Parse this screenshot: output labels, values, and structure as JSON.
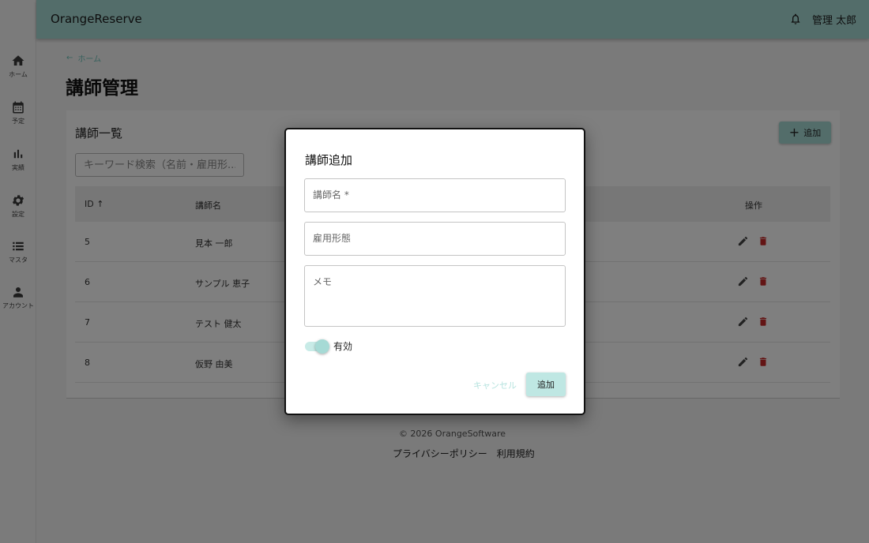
{
  "app": {
    "title": "OrangeReserve"
  },
  "header": {
    "user_name": "管理 太郎"
  },
  "sidebar": {
    "items": [
      {
        "label": "ホーム",
        "icon": "home-icon"
      },
      {
        "label": "予定",
        "icon": "calendar-icon"
      },
      {
        "label": "実績",
        "icon": "bar-chart-icon"
      },
      {
        "label": "設定",
        "icon": "gear-icon"
      },
      {
        "label": "マスタ",
        "icon": "list-icon"
      },
      {
        "label": "アカウント",
        "icon": "person-icon"
      }
    ]
  },
  "breadcrumb": {
    "label": "ホーム"
  },
  "page": {
    "title": "講師管理"
  },
  "list": {
    "title": "講師一覧",
    "add_label": "追加",
    "search_placeholder": "キーワード検索（名前・雇用形..."
  },
  "table": {
    "headers": {
      "id": "ID ↑",
      "name": "講師名",
      "actions": "操作"
    },
    "rows": [
      {
        "id": "5",
        "name": "見本 一郎"
      },
      {
        "id": "6",
        "name": "サンプル 恵子"
      },
      {
        "id": "7",
        "name": "テスト 健太"
      },
      {
        "id": "8",
        "name": "仮野 由美"
      }
    ]
  },
  "footer": {
    "copyright": "© 2026 OrangeSoftware",
    "privacy": "プライバシーポリシー",
    "terms": "利用規約"
  },
  "dialog": {
    "title": "講師追加",
    "name_placeholder": "講師名 *",
    "employment_placeholder": "雇用形態",
    "memo_placeholder": "メモ",
    "active_label": "有効",
    "active_on": true,
    "cancel_label": "キャンセル",
    "submit_label": "追加"
  },
  "colors": {
    "brand": "#a6dad5",
    "delete": "#c62828",
    "link": "#6fc2ba"
  }
}
